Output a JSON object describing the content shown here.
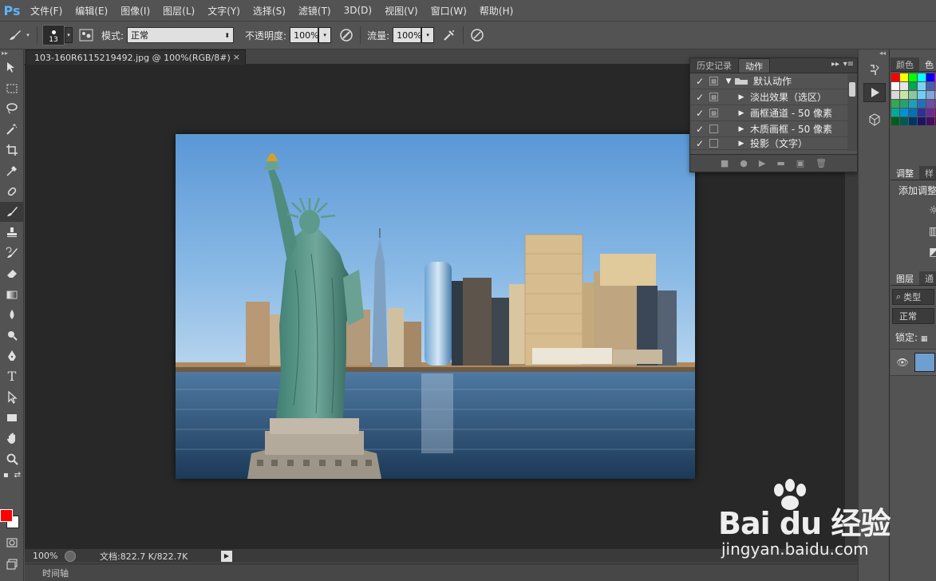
{
  "app": {
    "logo": "Ps"
  },
  "menu": [
    "文件(F)",
    "编辑(E)",
    "图像(I)",
    "图层(L)",
    "文字(Y)",
    "选择(S)",
    "滤镜(T)",
    "3D(D)",
    "视图(V)",
    "窗口(W)",
    "帮助(H)"
  ],
  "options": {
    "brush_size": "13",
    "mode_label": "模式:",
    "mode_value": "正常",
    "opacity_label": "不透明度:",
    "opacity_value": "100%",
    "flow_label": "流量:",
    "flow_value": "100%"
  },
  "document": {
    "tab_title": "103-160R6115219492.jpg @ 100%(RGB/8#)",
    "close_glyph": "×"
  },
  "status": {
    "zoom": "100%",
    "doc_info": "文档:822.7 K/822.7K"
  },
  "timeline": {
    "label": "时间轴"
  },
  "actions_panel": {
    "tab_history": "历史记录",
    "tab_actions": "动作",
    "items": [
      {
        "label": "默认动作",
        "checked": true,
        "dialog": true,
        "folder": true,
        "expanded": true
      },
      {
        "label": "淡出效果（选区）",
        "checked": true,
        "dialog": true,
        "folder": false,
        "expanded": false
      },
      {
        "label": "画框通道 - 50 像素",
        "checked": true,
        "dialog": true,
        "folder": false,
        "expanded": false
      },
      {
        "label": "木质画框 - 50 像素",
        "checked": true,
        "dialog": false,
        "folder": false,
        "expanded": false
      },
      {
        "label": "投影（文字）",
        "checked": true,
        "dialog": false,
        "folder": false,
        "expanded": false
      }
    ]
  },
  "color_panel": {
    "tab_color": "颜色",
    "tab_swatches": "色",
    "swatch_colors": [
      "#ff0000",
      "#ffff00",
      "#00ff00",
      "#00ffff",
      "#0000ff",
      "#ff00ff",
      "#ffffff",
      "#e5e5e5",
      "#00a651",
      "#7fd1f2",
      "#4c5ea7",
      "#a04fa0",
      "#d9d9d9",
      "#c7e6a3",
      "#8cc79f",
      "#6dcff6",
      "#7fa6d9",
      "#a98bc4",
      "#34a853",
      "#2c9e74",
      "#1f9fb7",
      "#2470b8",
      "#6a4fa3",
      "#8a3b8f",
      "#00a99d",
      "#0093d0",
      "#0072bc",
      "#2e3192",
      "#662d91",
      "#9e005d",
      "#005e20",
      "#005952",
      "#003663",
      "#1b1464",
      "#440e62",
      "#7a0026"
    ]
  },
  "adjust_panel": {
    "tab_adjust": "调整",
    "tab_styles": "样",
    "add_label": "添加调整"
  },
  "layers_panel": {
    "tab_layers": "图层",
    "tab_channels": "通",
    "filter_label": "类型",
    "blend_mode": "正常",
    "lock_label": "锁定:"
  },
  "watermark": {
    "main": "Bai du 经验",
    "sub": "jingyan.baidu.com"
  }
}
